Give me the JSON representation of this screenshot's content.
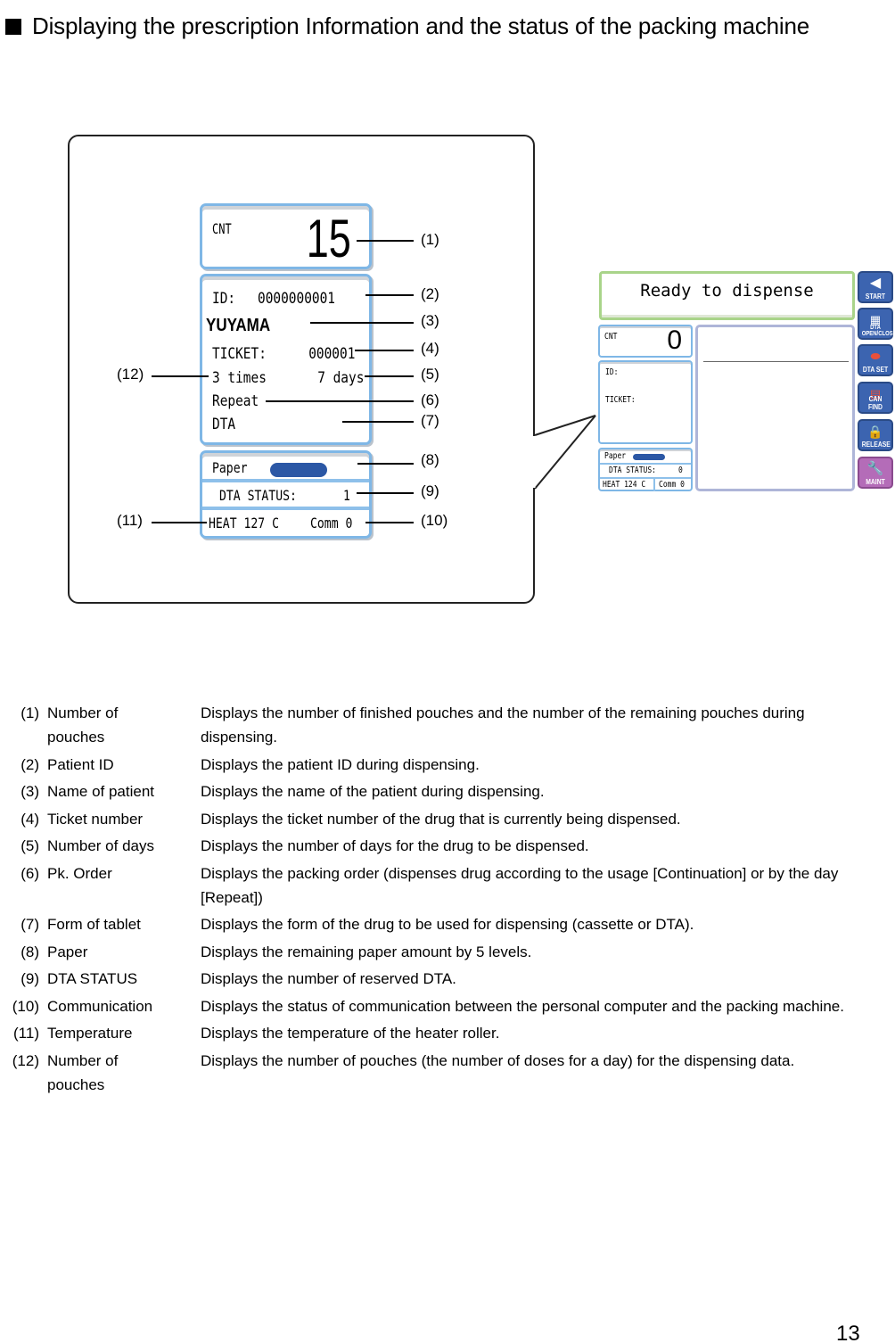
{
  "heading": "Displaying the prescription Information and the status of the packing machine",
  "detail_panel": {
    "cnt_label": "CNT",
    "cnt_value": "15",
    "id_label": "ID:",
    "id_value": "0000000001",
    "patient_name": "YUYAMA",
    "ticket_label": "TICKET:",
    "ticket_value": "000001",
    "times": "3 times",
    "days": "7 days",
    "pack_order": "Repeat",
    "tablet_form": "DTA",
    "paper_label": "Paper",
    "paper_level_fraction": 1.0,
    "dta_status_label": "DTA STATUS:",
    "dta_status_value": "1",
    "heat": "HEAT 127  C",
    "comm": "Comm 0"
  },
  "markers": [
    "(1)",
    "(2)",
    "(3)",
    "(4)",
    "(5)",
    "(6)",
    "(7)",
    "(8)",
    "(9)",
    "(10)",
    "(11)",
    "(12)"
  ],
  "screen": {
    "message": "Ready to dispense",
    "cnt_label": "CNT",
    "cnt_value": "0",
    "id_label": "ID:",
    "ticket_label": "TICKET:",
    "paper_label": "Paper",
    "dta_status_label": "DTA STATUS:",
    "dta_status_value": "0",
    "heat": "HEAT 124  C",
    "comm": "Comm 0",
    "buttons": [
      {
        "label": "START",
        "icon": "play-left-icon"
      },
      {
        "label": "DTA OPEN/CLOSE",
        "icon": "tray-icon"
      },
      {
        "label": "DTA SET",
        "icon": "pill-tray-icon"
      },
      {
        "label": "CAN FIND",
        "icon": "canister-icon"
      },
      {
        "label": "RELEASE",
        "icon": "padlock-icon"
      },
      {
        "label": "MAINT",
        "icon": "wrench-icon"
      }
    ]
  },
  "descriptions": [
    {
      "num": "(1)",
      "term": "Number of pouches",
      "desc": "Displays the number of finished pouches and the number of the remaining pouches during dispensing."
    },
    {
      "num": "(2)",
      "term": "Patient ID",
      "desc": "Displays the patient ID during dispensing."
    },
    {
      "num": "(3)",
      "term": "Name of patient",
      "desc": "Displays the name of the patient during dispensing."
    },
    {
      "num": "(4)",
      "term": "Ticket number",
      "desc": "Displays the ticket number of the drug that is currently being dispensed."
    },
    {
      "num": "(5)",
      "term": "Number of days",
      "desc": "Displays the number of days for the drug to be dispensed."
    },
    {
      "num": "(6)",
      "term": "Pk. Order",
      "desc": "Displays the packing order (dispenses drug according to the usage [Continuation] or by the day [Repeat])"
    },
    {
      "num": "(7)",
      "term": "Form of tablet",
      "desc": "Displays the form of the drug to be used for dispensing (cassette or DTA)."
    },
    {
      "num": "(8)",
      "term": "Paper",
      "desc": "Displays the remaining paper amount by 5 levels."
    },
    {
      "num": "(9)",
      "term": "DTA STATUS",
      "desc": "Displays the number of reserved DTA."
    },
    {
      "num": "(10)",
      "term": "Communication",
      "desc": "Displays the status of communication between the personal computer and the packing machine."
    },
    {
      "num": "(11)",
      "term": "Temperature",
      "desc": "Displays the temperature of the heater roller."
    },
    {
      "num": "(12)",
      "term": "Number of pouches",
      "desc": "Displays the number of pouches (the number of doses for a day) for the dispensing data."
    }
  ],
  "page_number": "13"
}
